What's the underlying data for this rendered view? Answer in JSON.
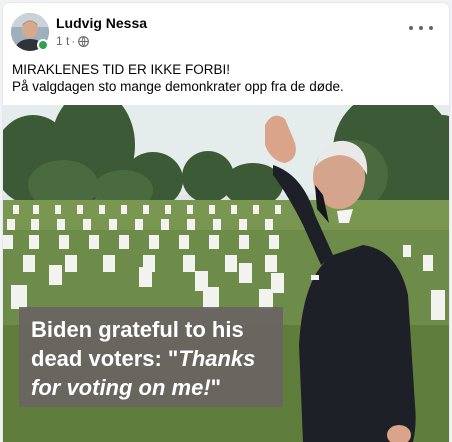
{
  "post": {
    "author": "Ludvig Nessa",
    "time": "1 t",
    "separator": "·",
    "privacy_icon": "globe-icon",
    "more_icon": "more-options-icon",
    "text_line1": "MIRAKLENES TID ER IKKE FORBI!",
    "text_line2": "På valgdagen sto mange demonkrater opp fra de døde."
  },
  "image": {
    "caption_line1": "Biden grateful to his",
    "caption_line2_plain": "dead voters: \"",
    "caption_line2_italic": "Thanks",
    "caption_line3_italic": "for voting on me!",
    "caption_line3_end": "\""
  },
  "colors": {
    "online": "#31a24c",
    "meta_text": "#65676b"
  }
}
